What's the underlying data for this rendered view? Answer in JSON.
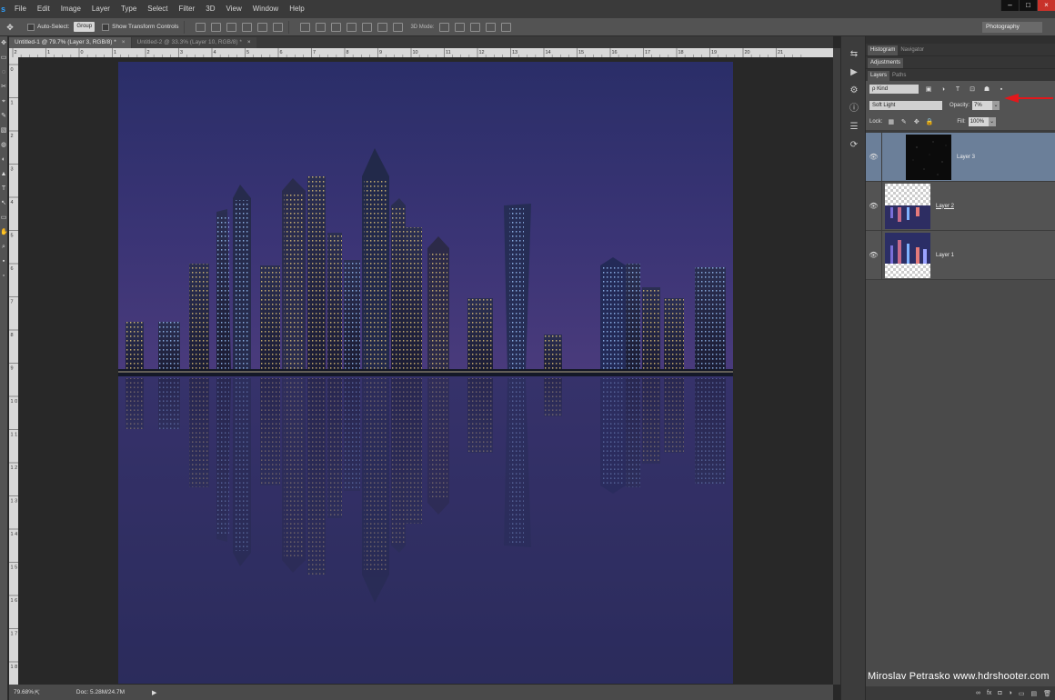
{
  "menubar": {
    "logo": "s",
    "items": [
      "File",
      "Edit",
      "Image",
      "Layer",
      "Type",
      "Select",
      "Filter",
      "3D",
      "View",
      "Window",
      "Help"
    ],
    "window_controls": [
      "–",
      "□",
      "×"
    ]
  },
  "optionsbar": {
    "move_tool": "✥",
    "auto_select_label": "Auto-Select:",
    "auto_select_value": "Group",
    "transform_label": "Show Transform Controls",
    "mode_3d_label": "3D Mode:",
    "workspace": "Photography"
  },
  "tools": [
    "✥",
    "▭",
    "◌",
    "✂",
    "⌖",
    "✎",
    "▧",
    "◍",
    "◐",
    "▲",
    "T",
    "↖",
    "▭",
    "✋",
    "⌕",
    "▪",
    "▫"
  ],
  "tabs": [
    {
      "label": "Untitled-1 @ 79.7% (Layer 3, RGB/8) *",
      "close": "×"
    },
    {
      "label": "Untitled-2 @ 33.3% (Layer 10, RGB/8) *",
      "close": "×"
    }
  ],
  "ruler_top_labels": [
    "2",
    "1",
    "0",
    "1",
    "2",
    "3",
    "4",
    "5",
    "6",
    "7",
    "8",
    "9",
    "10",
    "11",
    "12",
    "13",
    "14",
    "15",
    "16",
    "17",
    "18",
    "19",
    "20",
    "21"
  ],
  "ruler_left_labels": [
    "0",
    "1",
    "2",
    "3",
    "4",
    "5",
    "6",
    "7",
    "8",
    "9",
    "1 0",
    "1 1",
    "1 2",
    "1 3",
    "1 4",
    "1 5",
    "1 6",
    "1 7",
    "1 8"
  ],
  "status": {
    "zoom": "79.68%",
    "doc": "Doc: 5.28M/24.7M",
    "arrow": "▶"
  },
  "dock_icons": [
    "⇆",
    "▶",
    "⚙",
    "ⓘ",
    "☰",
    "⟳"
  ],
  "panels": {
    "top_tabs": [
      "Histogram",
      "Navigator"
    ],
    "adjustments_tab": "Adjustments",
    "layer_tabs": [
      "Layers",
      "Paths"
    ],
    "kind_filter": "ρ Kind",
    "filter_icons": [
      "▣",
      "◑",
      "T",
      "⊡",
      "☗",
      "▪"
    ],
    "blend_mode": "Soft Light",
    "opacity_label": "Opacity:",
    "opacity_value": "7%",
    "lock_label": "Lock:",
    "lock_icons": [
      "▦",
      "✎",
      "✥",
      "🔒"
    ],
    "fill_label": "Fill:",
    "fill_value": "100%",
    "dropdown_caret": "⌄",
    "layers": [
      {
        "name": "Layer 3",
        "visible": "👁",
        "selected": true
      },
      {
        "name": "Layer 2",
        "visible": "👁",
        "selected": false
      },
      {
        "name": "Layer 1",
        "visible": "👁",
        "selected": false
      }
    ],
    "footer_icons": [
      "∞",
      "fx",
      "◘",
      "◑",
      "▭",
      "▤",
      "🗑"
    ]
  },
  "credit": "Miroslav  Petrasko  www.hdrshooter.com",
  "colors": {
    "accent_arrow": "#e3171b",
    "selected_layer": "#6b7f99",
    "sky_top": "#2b2f66",
    "water": "#2c2b5c"
  }
}
